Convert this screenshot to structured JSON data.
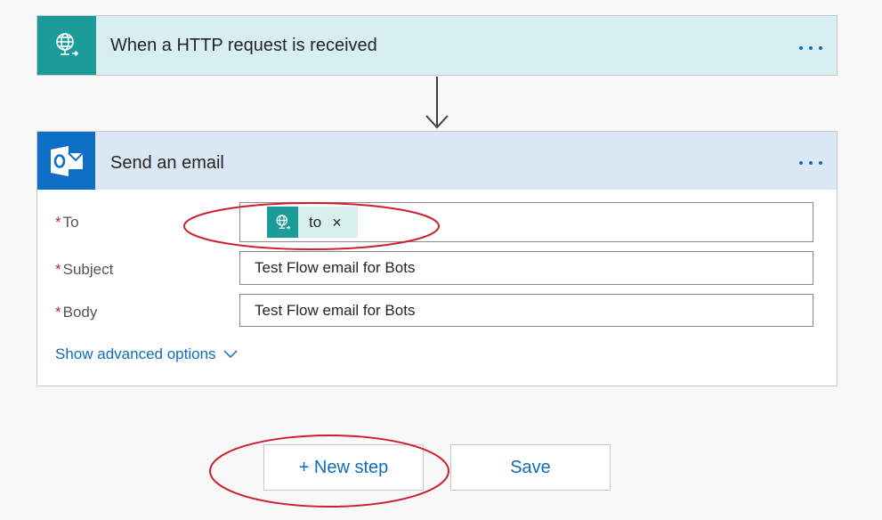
{
  "trigger": {
    "title": "When a HTTP request is received",
    "icon": "globe-request-icon",
    "color": "#1b9c99"
  },
  "action": {
    "title": "Send an email",
    "icon": "outlook-icon",
    "color": "#0f6fc6",
    "fields": {
      "to": {
        "label": "To",
        "required_marker": "*",
        "token": {
          "label": "to",
          "remove": "×",
          "icon": "globe-request-icon"
        }
      },
      "subject": {
        "label": "Subject",
        "required_marker": "*",
        "value": "Test Flow email for Bots"
      },
      "body": {
        "label": "Body",
        "required_marker": "*",
        "value": "Test Flow email for Bots"
      }
    },
    "advanced_label": "Show advanced options"
  },
  "buttons": {
    "new_step": "+ New step",
    "save": "Save"
  },
  "annotation": {
    "color": "#cc1f2f"
  }
}
